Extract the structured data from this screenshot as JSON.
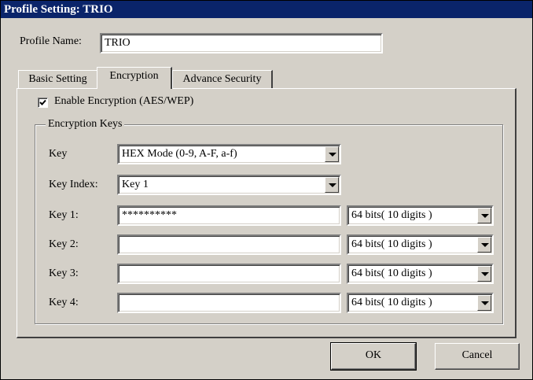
{
  "window": {
    "title": "Profile Setting: TRIO"
  },
  "profile": {
    "name_label": "Profile Name:",
    "name_value": "TRIO"
  },
  "tabs": [
    {
      "label": "Basic Setting",
      "active": false
    },
    {
      "label": "Encryption",
      "active": true
    },
    {
      "label": "Advance Security",
      "active": false
    }
  ],
  "encryption": {
    "enable_label": "Enable Encryption (AES/WEP)",
    "enable_checked": true,
    "group_title": "Encryption Keys",
    "key_label": "Key",
    "key_mode": "HEX Mode (0-9, A-F, a-f)",
    "key_index_label": "Key Index:",
    "key_index": "Key 1",
    "keys": [
      {
        "label": "Key 1:",
        "value": "**********",
        "size": "64 bits( 10 digits )"
      },
      {
        "label": "Key 2:",
        "value": "",
        "size": "64 bits( 10 digits )"
      },
      {
        "label": "Key 3:",
        "value": "",
        "size": "64 bits( 10 digits )"
      },
      {
        "label": "Key 4:",
        "value": "",
        "size": "64 bits( 10 digits )"
      }
    ]
  },
  "buttons": {
    "ok": "OK",
    "cancel": "Cancel"
  }
}
